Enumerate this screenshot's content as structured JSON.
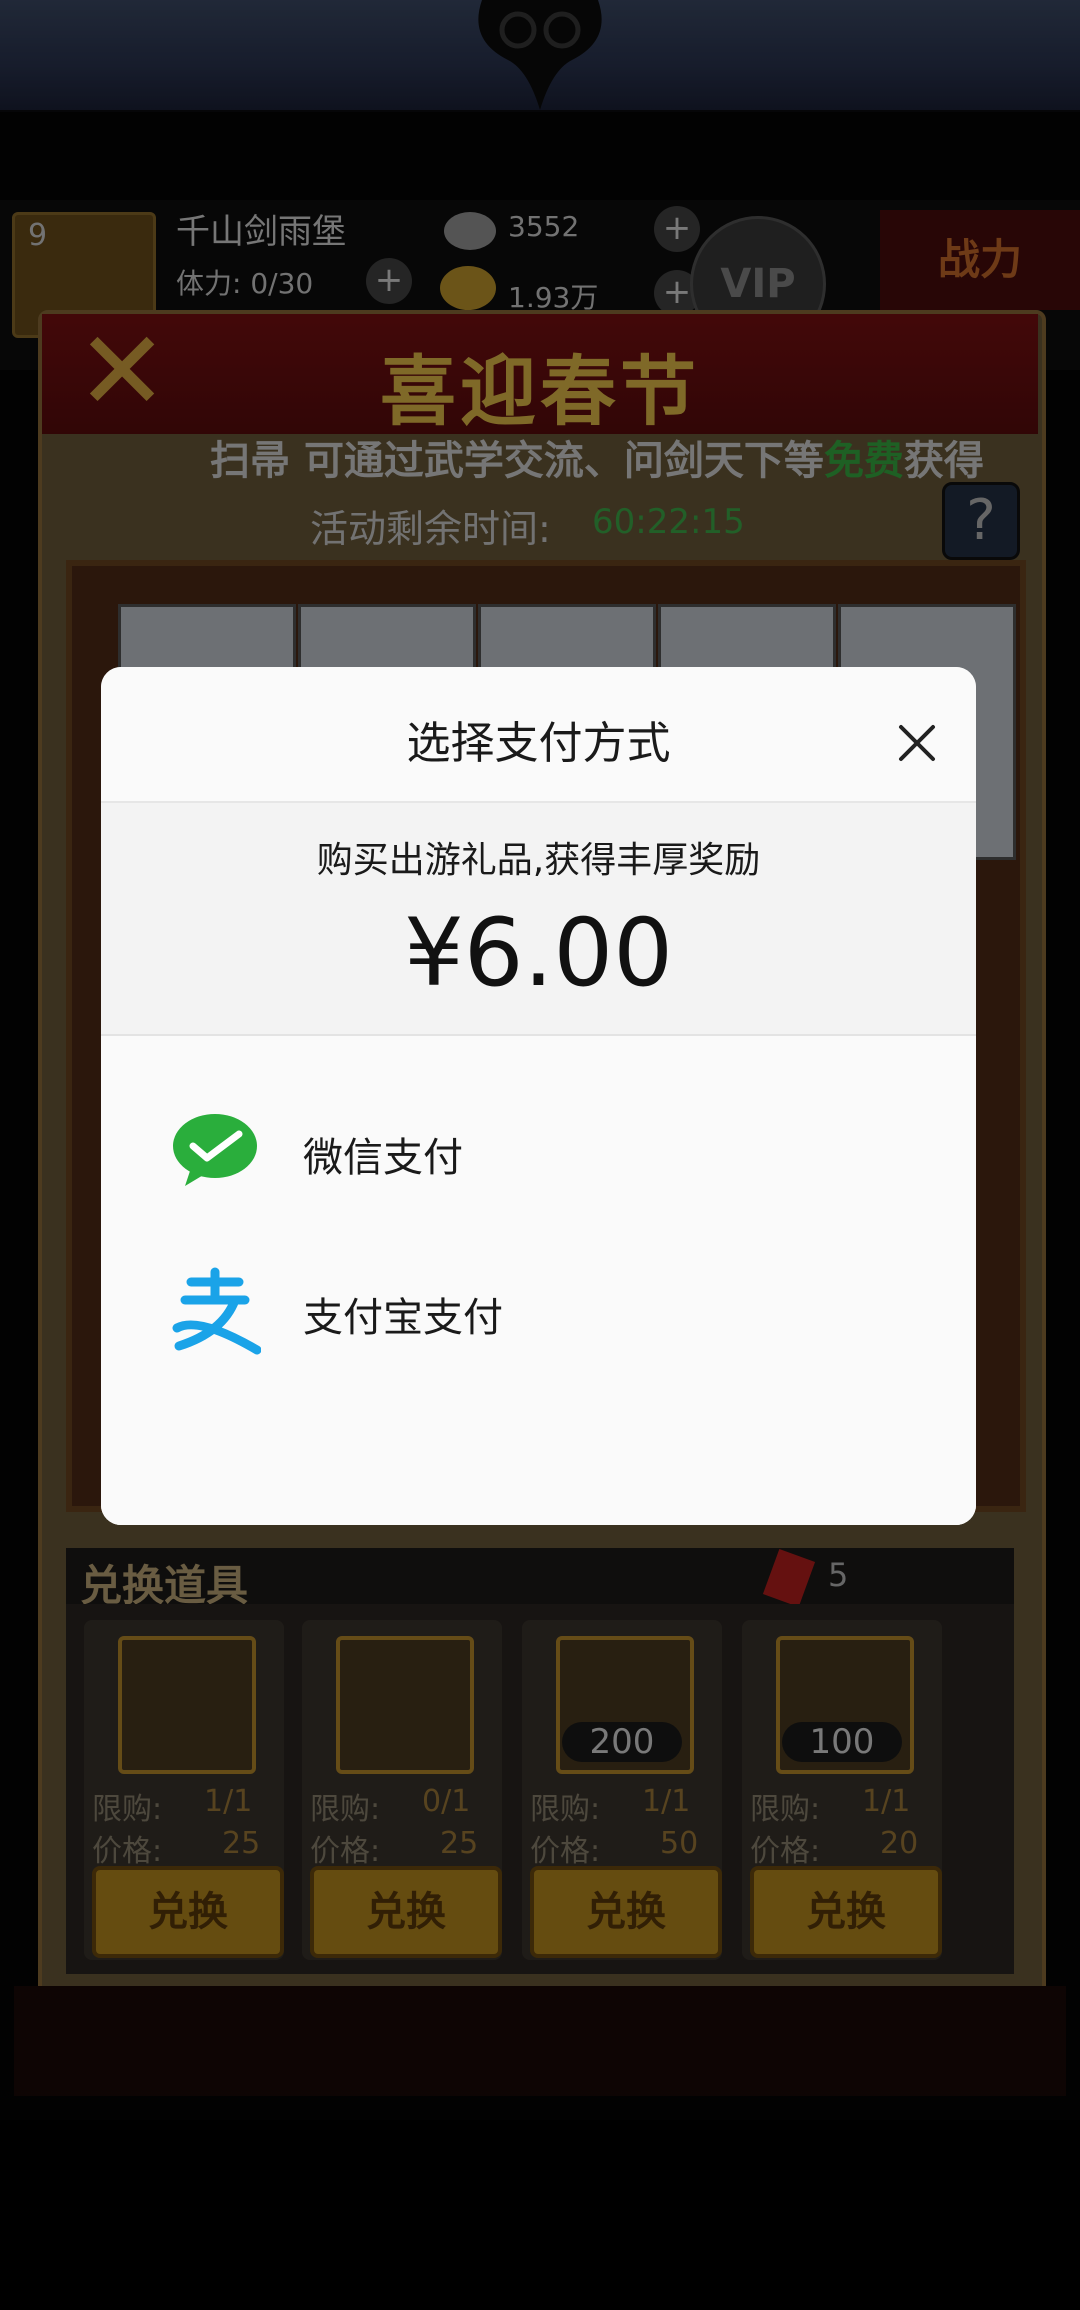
{
  "game": {
    "level": "9",
    "player_name": "千山剑雨堡",
    "stamina": "体力: 0/30",
    "silver": "3552",
    "gold": "1.93万",
    "vip": "VIP",
    "power_label": "战力",
    "panel_title": "喜迎春节",
    "banner_prefix": "扫帚",
    "banner_middle": "可通过武学交流、问剑天下等",
    "banner_highlight": "免费",
    "banner_suffix": "获得",
    "timer_label": "活动剩余时间:",
    "timer_value": "60:22:15",
    "help": "?",
    "exchange_section": "兑换道具",
    "ticket_count": "5",
    "items": [
      {
        "limit_label": "限购:",
        "limit": "1/1",
        "price_label": "价格:",
        "price": "25",
        "badge": "",
        "button": "兑换"
      },
      {
        "limit_label": "限购:",
        "limit": "0/1",
        "price_label": "价格:",
        "price": "25",
        "badge": "",
        "button": "兑换"
      },
      {
        "limit_label": "限购:",
        "limit": "1/1",
        "price_label": "价格:",
        "price": "50",
        "badge": "200",
        "button": "兑换"
      },
      {
        "limit_label": "限购:",
        "limit": "1/1",
        "price_label": "价格:",
        "price": "20",
        "badge": "100",
        "button": "兑换"
      }
    ]
  },
  "payment_dialog": {
    "title": "选择支付方式",
    "description": "购买出游礼品,获得丰厚奖励",
    "price": "¥6.00",
    "methods": [
      {
        "label": "微信支付",
        "icon": "wechat-pay-icon",
        "color": "#2aae3c"
      },
      {
        "label": "支付宝支付",
        "icon": "alipay-icon",
        "color": "#1aa3e8"
      }
    ]
  }
}
